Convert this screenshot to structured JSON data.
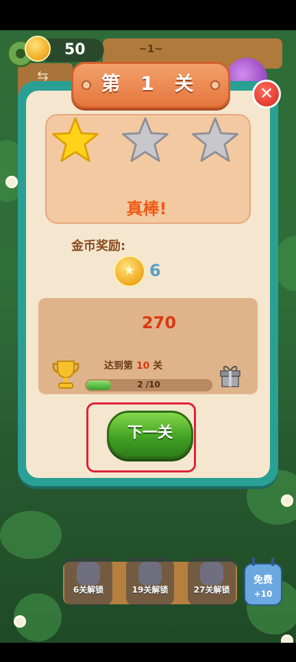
{
  "hud": {
    "coins": "50",
    "level_tag": "~1~"
  },
  "dialog": {
    "title": "第 1 关",
    "close_symbol": "✕",
    "stars_earned": 1,
    "stars_total": 3,
    "praise": "真棒!",
    "reward_label": "金币奖励:",
    "reward_value": "6",
    "score": "270",
    "goal_prefix": "达到第",
    "goal_level": "10",
    "goal_suffix": "关",
    "progress_text": "2  /10",
    "progress_fraction": 0.2,
    "next_button_label": "下一关"
  },
  "bottom": {
    "locks": [
      {
        "label": "6关解锁"
      },
      {
        "label": "19关解锁"
      },
      {
        "label": "27关解锁"
      }
    ],
    "free": {
      "label": "免费",
      "bonus": "+10"
    }
  },
  "colors": {
    "panel_frame": "#2a9f94",
    "panel_body": "#f4e6cf",
    "accent_orange": "#e5763e",
    "score_red": "#d93a12",
    "button_green": "#3f9e22",
    "highlight_red": "#e0203a"
  },
  "icons": [
    "gear-icon",
    "coin-icon",
    "swap-icon",
    "close-icon",
    "star-icon",
    "trophy-icon",
    "gift-icon",
    "lock-icon"
  ]
}
